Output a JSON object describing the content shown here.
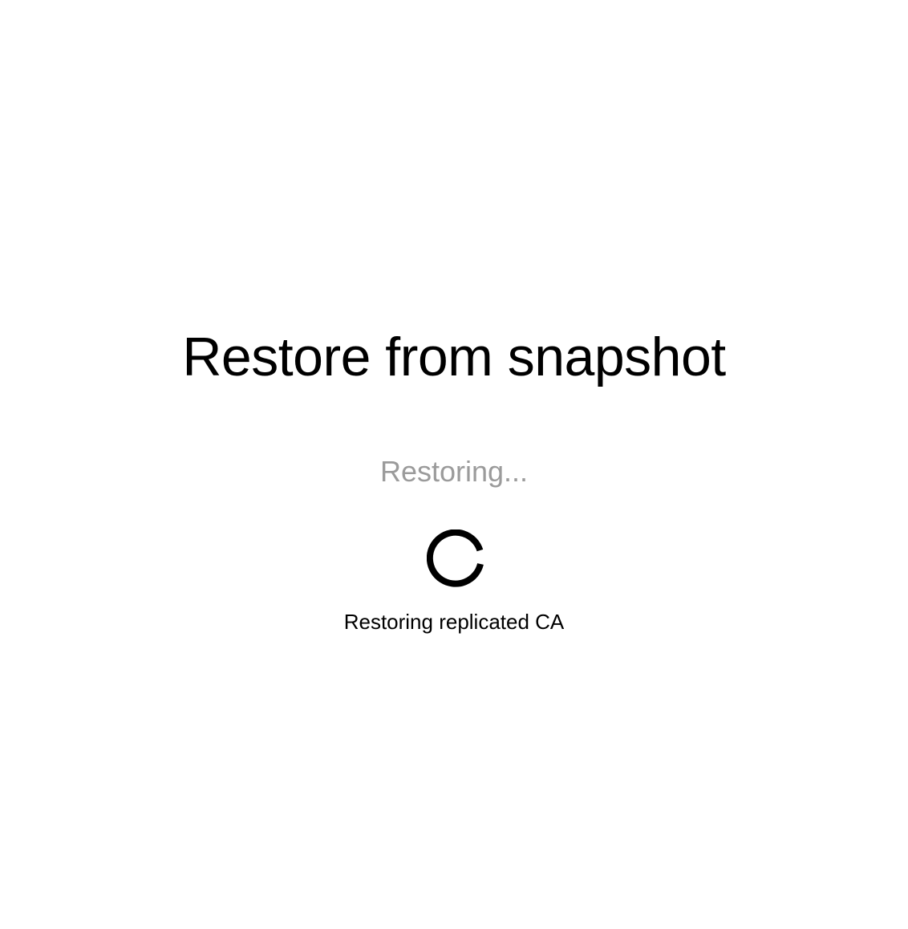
{
  "page": {
    "title": "Restore from snapshot",
    "status": "Restoring...",
    "spinner_icon": "loading-spinner-icon",
    "step": "Restoring replicated CA"
  },
  "colors": {
    "background": "#ffffff",
    "title": "#000000",
    "status": "#9b9b9b",
    "spinner": "#000000",
    "step": "#000000"
  }
}
